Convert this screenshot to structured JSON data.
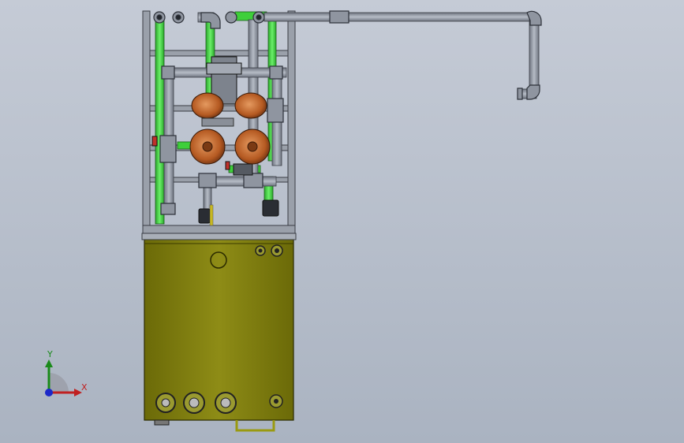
{
  "viewport": {
    "background_top": "#c5cbd6",
    "background_bottom": "#aab3c1"
  },
  "model": {
    "description_icon": "3d-assembly-model",
    "colors": {
      "frame": "#8a8f98",
      "pipe_gray": "#8f95a0",
      "pipe_green": "#3ecf3a",
      "tank": "#8a8a10",
      "pump": "#b55a22"
    }
  },
  "triad": {
    "y_label": "Y",
    "x_label": "X",
    "y_color": "#1a8a1a",
    "x_color": "#c02020",
    "z_color": "#1c28c8"
  }
}
